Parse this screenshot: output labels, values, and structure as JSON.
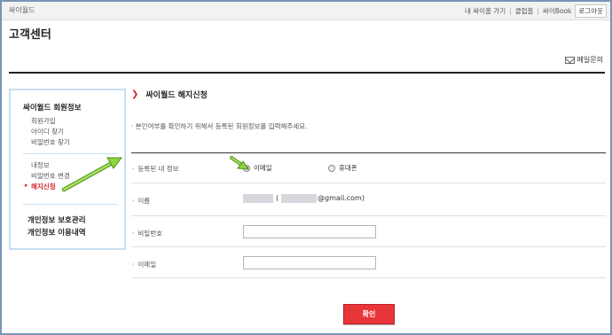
{
  "header": {
    "brand": "싸이월드",
    "links": [
      "내 싸이홈 가기",
      "클럽홈",
      "싸이Book"
    ],
    "logout_label": "로그아웃"
  },
  "page": {
    "title": "고객센터",
    "email_inquiry_label": "메일문의",
    "icons": [
      "mail-icon",
      "arrow-icon"
    ]
  },
  "sidebar": {
    "section1_title": "싸이월드 회원정보",
    "group1": [
      "회원가입",
      "아이디 찾기",
      "비밀번호 찾기"
    ],
    "group2": [
      "내정보",
      "비밀번호 변경",
      "해지신청"
    ],
    "active_index": 2,
    "bottom_links": [
      "개인정보 보호관리",
      "개인정보 이용내역"
    ],
    "accent_color": "#d6242a",
    "border_color": "#c8def1"
  },
  "content": {
    "title": "싸이월드 해지신청",
    "notice": "본인여부를 확인하기 위해서 등록된 회원정보를 입력해주세요.",
    "fields": {
      "info_label": "등록된 내 정보",
      "radio_email": "이메일",
      "radio_phone": "휴대폰",
      "selected": "이메일",
      "name_label": "이름",
      "name_paren_open": "(",
      "name_email_suffix": "@gmail.com)",
      "password_label": "비밀번호",
      "password_value": "",
      "email_label": "이메일",
      "email_value": ""
    },
    "confirm_label": "확인",
    "confirm_color": "#e8353a"
  }
}
